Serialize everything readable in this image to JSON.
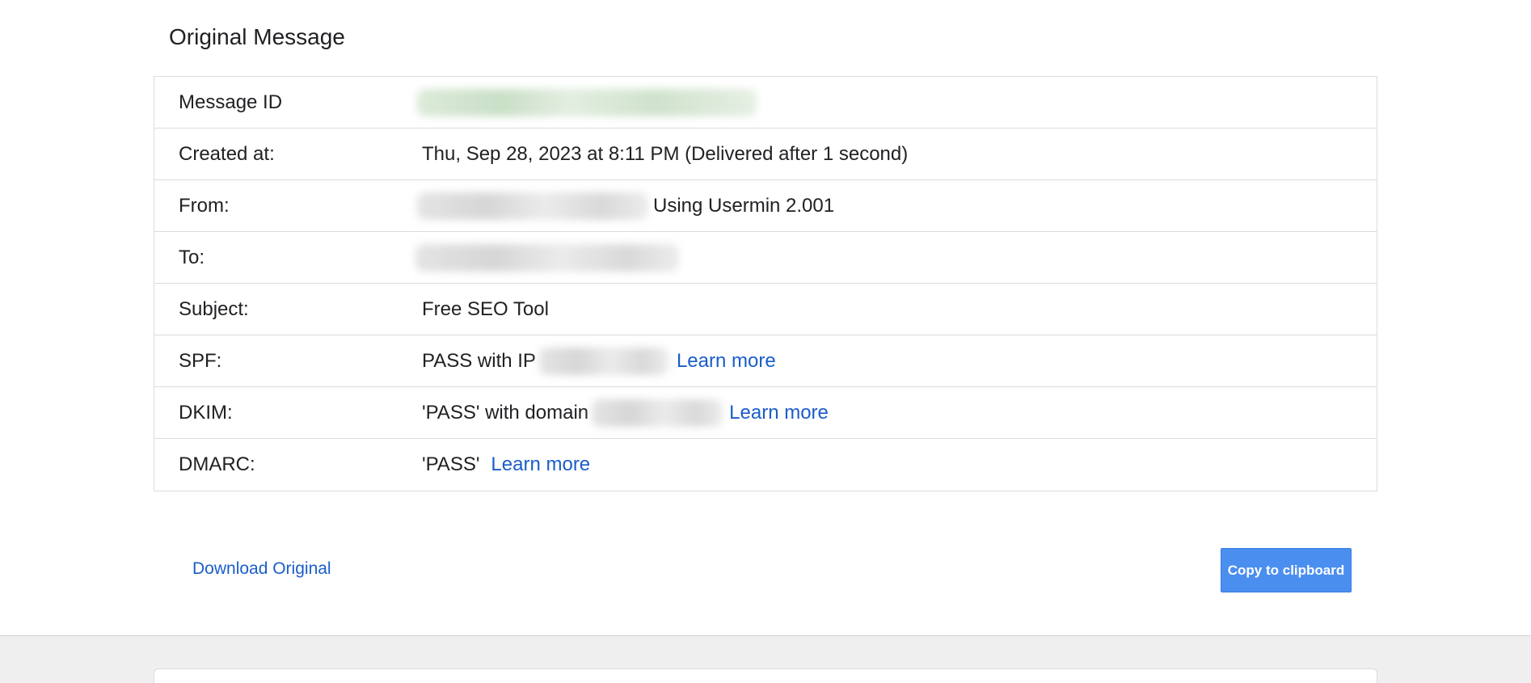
{
  "page": {
    "title": "Original Message"
  },
  "details": {
    "message_id": {
      "label": "Message ID"
    },
    "created_at": {
      "label": "Created at:",
      "value": "Thu, Sep 28, 2023 at 8:11 PM (Delivered after 1 second)"
    },
    "from": {
      "label": "From:",
      "suffix": "Using Usermin 2.001"
    },
    "to": {
      "label": "To:"
    },
    "subject": {
      "label": "Subject:",
      "value": "Free SEO Tool"
    },
    "spf": {
      "label": "SPF:",
      "prefix": "PASS with IP",
      "link": "Learn more"
    },
    "dkim": {
      "label": "DKIM:",
      "prefix": "'PASS' with domain",
      "link": "Learn more"
    },
    "dmarc": {
      "label": "DMARC:",
      "prefix": "'PASS'",
      "link": "Learn more"
    }
  },
  "actions": {
    "download_label": "Download Original",
    "copy_label": "Copy to clipboard"
  },
  "colors": {
    "link": "#1a5dc9",
    "button": "#4a8ef0",
    "border": "#dadce0",
    "footer_band": "#efefef"
  }
}
